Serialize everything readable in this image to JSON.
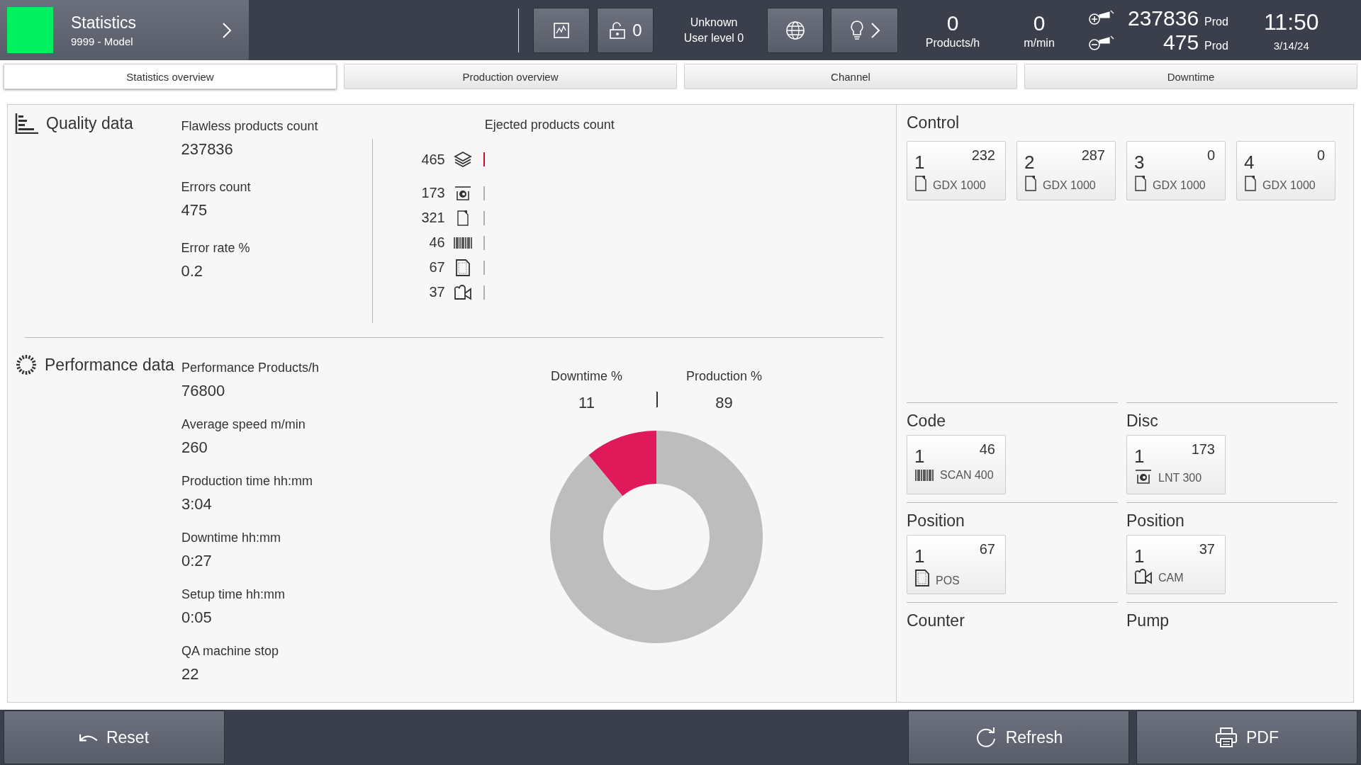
{
  "header": {
    "running": true,
    "title": "Statistics",
    "subtitle": "9999 - Model",
    "lock_count": "0",
    "user": "Unknown",
    "user_level": "User level 0",
    "rates": [
      {
        "value": "0",
        "unit": "Products/h"
      },
      {
        "value": "0",
        "unit": "m/min"
      }
    ],
    "counters": [
      {
        "value": "237836",
        "unit": "Prod"
      },
      {
        "value": "475",
        "unit": "Prod"
      }
    ],
    "time": "11:50",
    "date": "3/14/24"
  },
  "tabs": [
    {
      "label": "Statistics overview",
      "selected": true
    },
    {
      "label": "Production overview",
      "selected": false
    },
    {
      "label": "Channel",
      "selected": false
    },
    {
      "label": "Downtime",
      "selected": false
    }
  ],
  "quality": {
    "title": "Quality data",
    "metrics": [
      {
        "label": "Flawless products count",
        "value": "237836"
      },
      {
        "label": "Errors count",
        "value": "475"
      },
      {
        "label": "Error rate %",
        "value": "0.2"
      }
    ],
    "ejected_title": "Ejected products count",
    "ejected": [
      {
        "value": "465",
        "kind": "layers",
        "color": "#c8102e"
      },
      {
        "value": "173",
        "kind": "disc",
        "color": "#b0b0b0"
      },
      {
        "value": "321",
        "kind": "bottle",
        "color": "#b0b0b0"
      },
      {
        "value": "46",
        "kind": "barcode",
        "color": "#b0b0b0"
      },
      {
        "value": "67",
        "kind": "page",
        "color": "#b0b0b0"
      },
      {
        "value": "37",
        "kind": "camera",
        "color": "#b0b0b0"
      }
    ]
  },
  "performance": {
    "title": "Performance data",
    "metrics": [
      {
        "label": "Performance Products/h",
        "value": "76800"
      },
      {
        "label": "Average speed m/min",
        "value": "260"
      },
      {
        "label": "Production time hh:mm",
        "value": "3:04"
      },
      {
        "label": "Downtime hh:mm",
        "value": "0:27"
      },
      {
        "label": "Setup time hh:mm",
        "value": "0:05"
      },
      {
        "label": "QA machine stop",
        "value": "22"
      }
    ],
    "legend": [
      {
        "label": "Downtime %",
        "value": "11"
      },
      {
        "label": "Production %",
        "value": "89"
      }
    ],
    "chart_data": {
      "type": "donut",
      "series": [
        {
          "values": [
            11,
            89
          ]
        }
      ],
      "colors": [
        "#e0195a",
        "#bdbdbd"
      ]
    }
  },
  "control": {
    "title": "Control",
    "tiles": [
      {
        "number": "1",
        "count": "232",
        "kind": "bottle",
        "model": "GDX 1000"
      },
      {
        "number": "2",
        "count": "287",
        "kind": "bottle",
        "model": "GDX 1000"
      },
      {
        "number": "3",
        "count": "0",
        "kind": "bottle",
        "model": "GDX 1000"
      },
      {
        "number": "4",
        "count": "0",
        "kind": "bottle",
        "model": "GDX 1000"
      }
    ]
  },
  "groups": [
    {
      "title": "Code",
      "tiles": [
        {
          "number": "1",
          "count": "46",
          "kind": "barcode",
          "model": "SCAN 400"
        }
      ]
    },
    {
      "title": "Disc",
      "tiles": [
        {
          "number": "1",
          "count": "173",
          "kind": "disc",
          "model": "LNT 300"
        }
      ]
    },
    {
      "title": "Position",
      "tiles": [
        {
          "number": "1",
          "count": "67",
          "kind": "page",
          "model": "POS"
        }
      ]
    },
    {
      "title": "Position",
      "tiles": [
        {
          "number": "1",
          "count": "37",
          "kind": "camera",
          "model": "CAM"
        }
      ]
    },
    {
      "title": "Counter"
    },
    {
      "title": "Pump"
    }
  ],
  "footer": {
    "reset": "Reset",
    "refresh": "Refresh",
    "pdf": "PDF"
  }
}
